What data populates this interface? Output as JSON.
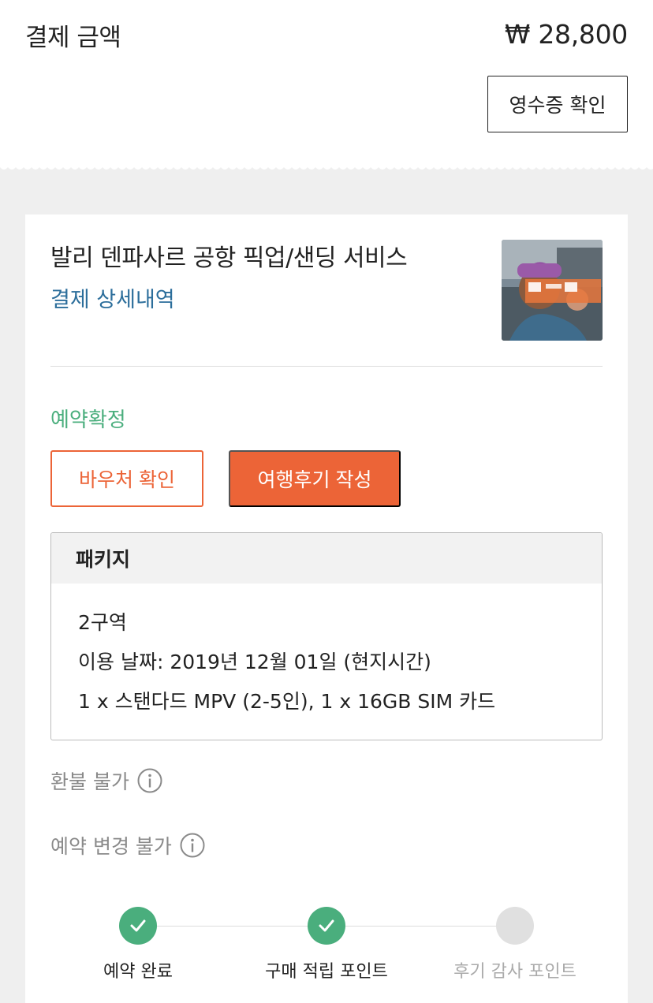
{
  "payment": {
    "label": "결제 금액",
    "amount": "₩ 28,800",
    "receipt_button": "영수증 확인"
  },
  "product": {
    "title": "발리 덴파사르 공항 픽업/샌딩 서비스",
    "detail_link": "결제 상세내역",
    "thumbnail_icon": "product-photo"
  },
  "booking": {
    "status": "예약확정",
    "voucher_button": "바우처 확인",
    "review_button": "여행후기 작성"
  },
  "package": {
    "header": "패키지",
    "zone": "2구역",
    "date": "이용 날짜: 2019년 12월 01일 (현지시간)",
    "items": "1 x 스탠다드 MPV (2-5인), 1 x 16GB SIM 카드"
  },
  "policies": {
    "refund": "환불 불가",
    "change": "예약 변경 불가"
  },
  "steps": [
    {
      "label": "예약 완료",
      "state": "done"
    },
    {
      "label": "구매 적립 포인트",
      "state": "done"
    },
    {
      "label": "후기 감사 포인트",
      "state": "pending"
    }
  ],
  "colors": {
    "accent": "#ec6437",
    "success": "#4aae7d",
    "link": "#2c6e9b"
  }
}
